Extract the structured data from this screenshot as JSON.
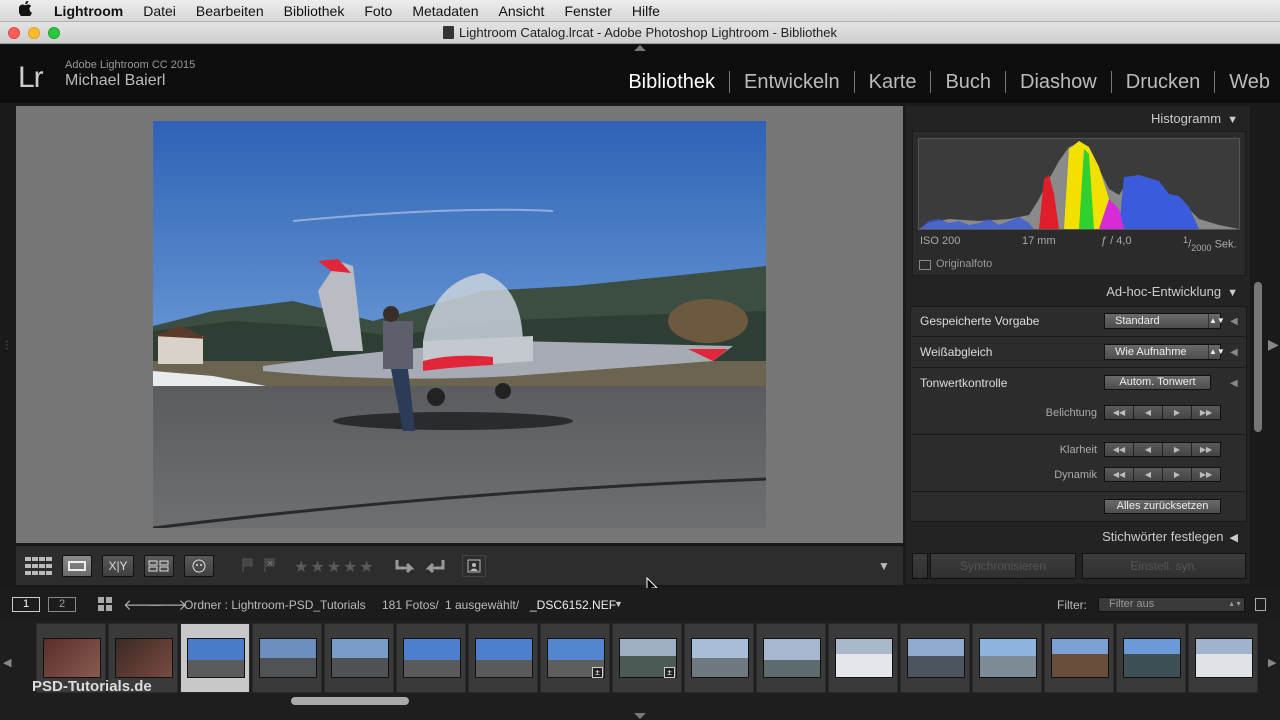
{
  "menubar": {
    "apple": "",
    "items": [
      "Lightroom",
      "Datei",
      "Bearbeiten",
      "Bibliothek",
      "Foto",
      "Metadaten",
      "Ansicht",
      "Fenster",
      "Hilfe"
    ]
  },
  "window": {
    "title": "Lightroom Catalog.lrcat - Adobe Photoshop Lightroom - Bibliothek"
  },
  "identity": {
    "logo": "Lr",
    "product": "Adobe Lightroom CC 2015",
    "user": "Michael Baierl"
  },
  "modules": [
    "Bibliothek",
    "Entwickeln",
    "Karte",
    "Buch",
    "Diashow",
    "Drucken",
    "Web"
  ],
  "active_module": "Bibliothek",
  "right_panel": {
    "histogram": {
      "title": "Histogramm",
      "iso": "ISO 200",
      "focal": "17 mm",
      "aperture": "ƒ / 4,0",
      "shutter_num": "1",
      "shutter_den": "2000",
      "shutter_unit": "Sek.",
      "original_label": "Originalfoto"
    },
    "quick_develop": {
      "title": "Ad-hoc-Entwicklung",
      "saved_preset_label": "Gespeicherte Vorgabe",
      "saved_preset_value": "Standard",
      "white_balance_label": "Weißabgleich",
      "white_balance_value": "Wie Aufnahme",
      "tone_label": "Tonwertkontrolle",
      "auto_tone": "Autom. Tonwert",
      "exposure": "Belichtung",
      "clarity": "Klarheit",
      "vibrance": "Dynamik",
      "reset_all": "Alles zurücksetzen"
    },
    "keywords_title": "Stichwörter festlegen",
    "sync_button": "Synchronisieren",
    "sync_settings_button": "Einstell. syn."
  },
  "status": {
    "screen1": "1",
    "screen2": "2",
    "path": "Ordner : Lightroom-PSD_Tutorials",
    "count": "181 Fotos/",
    "selected": "1 ausgewählt/",
    "filename": "_DSC6152.NEF",
    "filter_label": "Filter:",
    "filter_value": "Filter aus"
  },
  "filmstrip": {
    "count": 17,
    "selected_index": 2,
    "watermark": "PSD-Tutorials.de"
  },
  "colors": {
    "accent": "#ffffff",
    "panel": "#232323",
    "loupe_bg": "#777777"
  },
  "icons": [
    "apple-icon",
    "grid-view-icon",
    "loupe-view-icon",
    "compare-view-icon",
    "survey-view-icon",
    "people-view-icon",
    "flag-icon",
    "reject-flag-icon",
    "star-icon",
    "rotate-left-icon",
    "rotate-right-icon",
    "crop-icon",
    "dropdown-icon"
  ]
}
